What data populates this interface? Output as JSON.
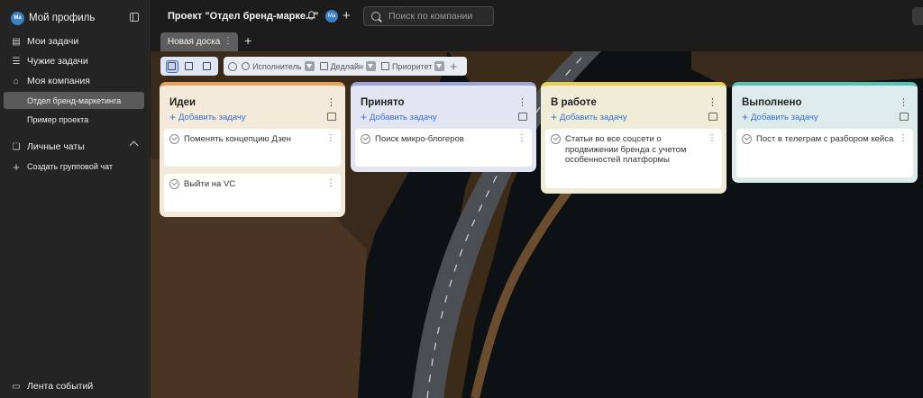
{
  "sidebar": {
    "profile": {
      "avatar_initials": "Ma",
      "name": "Мой профиль"
    },
    "items": [
      {
        "label": "Мои задачи",
        "icon": "tasks-icon"
      },
      {
        "label": "Чужие задачи",
        "icon": "list-icon"
      },
      {
        "label": "Моя компания",
        "icon": "company-icon"
      }
    ],
    "projects": [
      {
        "label": "Отдел бренд-маркетинга",
        "active": true
      },
      {
        "label": "Пример проекта",
        "active": false
      }
    ],
    "chats_label": "Личные чаты",
    "create_chat_label": "Создать групповой чат",
    "feed_label": "Лента событий"
  },
  "topbar": {
    "project_title": "Проект \"Отдел бренд-марке...\"",
    "avatar_initials": "Ma",
    "search_placeholder": "Поиск по компании"
  },
  "tabs": {
    "active_board": "Новая доска",
    "add_label": "+"
  },
  "toolbar": {
    "filters": [
      {
        "label": "Исполнитель"
      },
      {
        "label": "Дедлайн"
      },
      {
        "label": "Приоритет"
      }
    ]
  },
  "colors": {
    "ideas_accent": "#e8a15a",
    "accepted_accent": "#9aa6d9",
    "in_progress_accent": "#e8cf4a",
    "done_accent": "#56c2b5",
    "link_blue": "#3b6fd6"
  },
  "columns": [
    {
      "title": "Идеи",
      "add_label": "Добавить задачу",
      "cards": [
        "Поменять концепцию Дзен",
        "Выйти на VC"
      ]
    },
    {
      "title": "Принято",
      "add_label": "Добавить задачу",
      "cards": [
        "Поиск микро-блогеров"
      ]
    },
    {
      "title": "В работе",
      "add_label": "Добавить задачу",
      "cards": [
        "Статьи во все соцсети о продвижении бренда с учетом особенностей платформы"
      ]
    },
    {
      "title": "Выполнено",
      "add_label": "Добавить задачу",
      "cards": [
        "Пост в телеграм с разбором кейса"
      ]
    }
  ]
}
